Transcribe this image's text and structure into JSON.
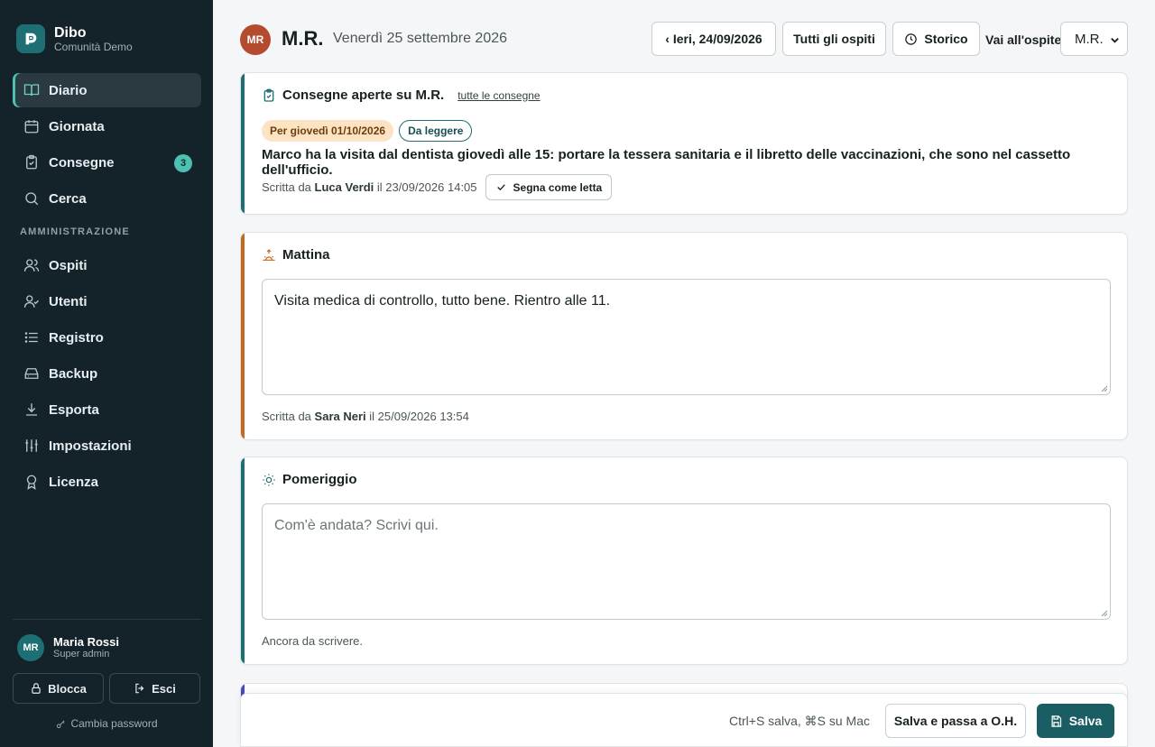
{
  "brand": {
    "name": "Dibo",
    "subtitle": "Comunità Demo"
  },
  "nav": {
    "items": [
      {
        "label": "Diario",
        "icon": "book-icon",
        "active": true
      },
      {
        "label": "Giornata",
        "icon": "calendar-icon"
      },
      {
        "label": "Consegne",
        "icon": "clipboard-icon",
        "badge": "3"
      },
      {
        "label": "Cerca",
        "icon": "search-icon"
      }
    ],
    "section_label": "AMMINISTRAZIONE",
    "admin_items": [
      {
        "label": "Ospiti",
        "icon": "users-icon"
      },
      {
        "label": "Utenti",
        "icon": "user-check-icon"
      },
      {
        "label": "Registro",
        "icon": "list-icon"
      },
      {
        "label": "Backup",
        "icon": "hard-drive-icon"
      },
      {
        "label": "Esporta",
        "icon": "download-icon"
      },
      {
        "label": "Impostazioni",
        "icon": "sliders-icon"
      },
      {
        "label": "Licenza",
        "icon": "award-icon"
      }
    ]
  },
  "user": {
    "initials": "MR",
    "name": "Maria Rossi",
    "role": "Super admin",
    "lock_label": "Blocca",
    "logout_label": "Esci",
    "change_password_label": "Cambia password"
  },
  "header": {
    "guest_initials": "MR",
    "guest_name": "M.R.",
    "date": "Venerdì 25 settembre 2026",
    "prev_label": "‹ Ieri, 24/09/2026",
    "all_guests_label": "Tutti gli ospiti",
    "history_label": "Storico",
    "goto_label": "Vai all'ospite",
    "goto_value": "M.R."
  },
  "handover": {
    "title": "Consegne aperte su M.R.",
    "all_link": "tutte le consegne",
    "due_chip": "Per giovedì 01/10/2026",
    "status_chip": "Da leggere",
    "text": "Marco ha la visita dal dentista giovedì alle 15: portare la tessera sanitaria e il libretto delle vaccinazioni, che sono nel cassetto dell'ufficio.",
    "meta_prefix": "Scritta da",
    "author": "Luca Verdi",
    "meta_date": "il 23/09/2026 14:05",
    "mark_read_label": "Segna come letta",
    "accent": "#1d6f74"
  },
  "morning": {
    "title": "Mattina",
    "value": "Visita medica di controllo, tutto bene. Rientro alle 11.",
    "meta_prefix": "Scritta da",
    "author": "Sara Neri",
    "meta_date": "il 25/09/2026 13:54",
    "accent": "#c36b1c"
  },
  "afternoon": {
    "title": "Pomeriggio",
    "placeholder": "Com'è andata? Scrivi qui.",
    "status": "Ancora da scrivere.",
    "accent": "#1d6f74"
  },
  "footer": {
    "shortcut": "Ctrl+S salva, ⌘S su Mac",
    "save_next_label": "Salva e passa a O.H.",
    "save_label": "Salva",
    "primary_color": "#1a5e63"
  }
}
